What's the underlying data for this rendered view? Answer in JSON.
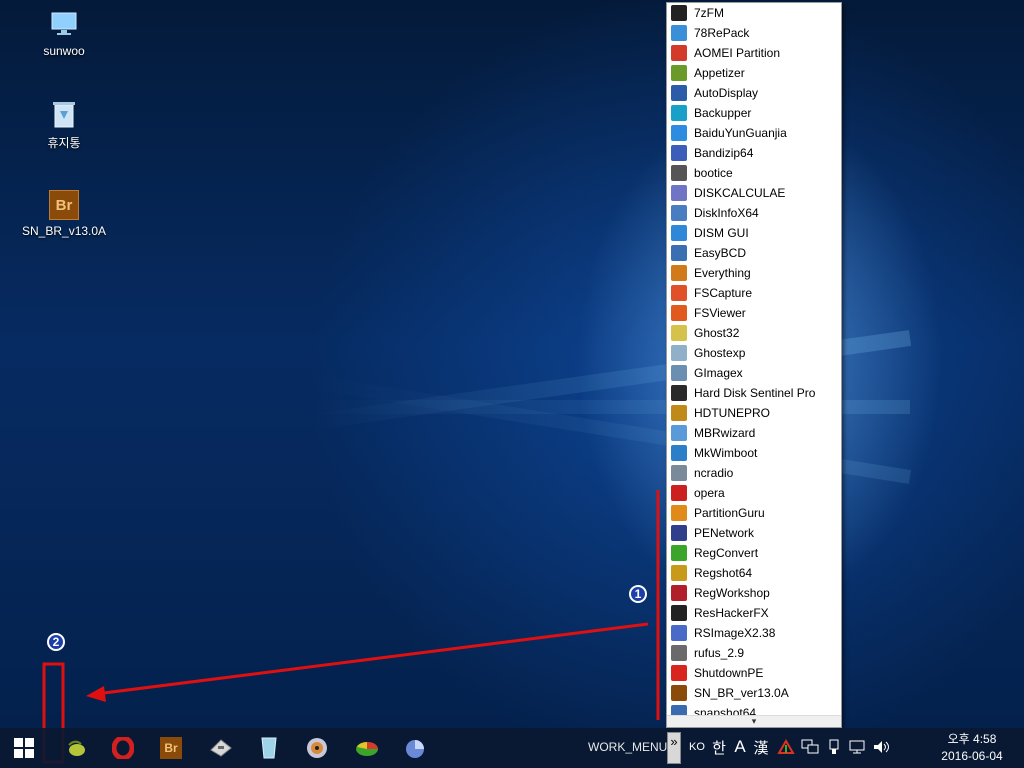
{
  "desktop": {
    "icons": [
      {
        "label": "sunwoo",
        "icon": "computer-icon"
      },
      {
        "label": "휴지통",
        "icon": "recycle-bin-icon"
      },
      {
        "label": "SN_BR_v13.0A",
        "icon": "br-app-icon"
      }
    ]
  },
  "menu": {
    "items": [
      {
        "label": "7zFM",
        "icon": "7zip-icon",
        "color": "#222222"
      },
      {
        "label": "78RePack",
        "icon": "triangle-icon",
        "color": "#3a8fd6"
      },
      {
        "label": "AOMEI Partition",
        "icon": "aomei-icon",
        "color": "#d23b2a"
      },
      {
        "label": "Appetizer",
        "icon": "appetizer-icon",
        "color": "#6a9a2a"
      },
      {
        "label": "AutoDisplay",
        "icon": "monitor-icon",
        "color": "#2a5ca8"
      },
      {
        "label": "Backupper",
        "icon": "backup-icon",
        "color": "#19a0c9"
      },
      {
        "label": "BaiduYunGuanjia",
        "icon": "cloud-icon",
        "color": "#2d8be0"
      },
      {
        "label": "Bandizip64",
        "icon": "bandizip-icon",
        "color": "#3b5fb8"
      },
      {
        "label": "bootice",
        "icon": "disk-icon",
        "color": "#555555"
      },
      {
        "label": "DISKCALCULAE",
        "icon": "disk-calc-icon",
        "color": "#6f74c4"
      },
      {
        "label": "DiskInfoX64",
        "icon": "person-icon",
        "color": "#4a7cc2"
      },
      {
        "label": "DISM GUI",
        "icon": "windows-icon",
        "color": "#2f87d8"
      },
      {
        "label": "EasyBCD",
        "icon": "easybcd-icon",
        "color": "#3a6fb2"
      },
      {
        "label": "Everything",
        "icon": "magnifier-icon",
        "color": "#d07a1c"
      },
      {
        "label": "FSCapture",
        "icon": "fscapture-icon",
        "color": "#e0512a"
      },
      {
        "label": "FSViewer",
        "icon": "fsviewer-icon",
        "color": "#e05a1e"
      },
      {
        "label": "Ghost32",
        "icon": "ghost-icon",
        "color": "#d4c24a"
      },
      {
        "label": "Ghostexp",
        "icon": "ghost-icon",
        "color": "#8fb0c8"
      },
      {
        "label": "GImagex",
        "icon": "gimagex-icon",
        "color": "#6a8fb0"
      },
      {
        "label": "Hard Disk Sentinel Pro",
        "icon": "hdd-icon",
        "color": "#2a2a2a"
      },
      {
        "label": "HDTUNEPRO",
        "icon": "hdtune-icon",
        "color": "#c08a1a"
      },
      {
        "label": "MBRwizard",
        "icon": "wizard-icon",
        "color": "#5a9ad8"
      },
      {
        "label": "MkWimboot",
        "icon": "wimboot-icon",
        "color": "#2a7fc8"
      },
      {
        "label": "ncradio",
        "icon": "grid-icon",
        "color": "#7a8a9a"
      },
      {
        "label": "opera",
        "icon": "opera-icon",
        "color": "#cc1f1f"
      },
      {
        "label": "PartitionGuru",
        "icon": "partitionguru-icon",
        "color": "#e08a1a"
      },
      {
        "label": "PENetwork",
        "icon": "network-icon",
        "color": "#2f3f8a"
      },
      {
        "label": "RegConvert",
        "icon": "regconvert-icon",
        "color": "#3aa52a"
      },
      {
        "label": "Regshot64",
        "icon": "regshot-icon",
        "color": "#c79a1a"
      },
      {
        "label": "RegWorkshop",
        "icon": "regworkshop-icon",
        "color": "#b0202a"
      },
      {
        "label": "ResHackerFX",
        "icon": "reshacker-icon",
        "color": "#222222"
      },
      {
        "label": "RSImageX2.38",
        "icon": "rsimagex-icon",
        "color": "#4a6ac8"
      },
      {
        "label": "rufus_2.9",
        "icon": "usb-icon",
        "color": "#6a6a6a"
      },
      {
        "label": "ShutdownPE",
        "icon": "power-icon",
        "color": "#d8261e"
      },
      {
        "label": "SN_BR_ver13.0A",
        "icon": "br-app-icon",
        "color": "#8a4a0a"
      },
      {
        "label": "snapshot64",
        "icon": "snapshot-icon",
        "color": "#3a6ab0"
      }
    ],
    "scroll_arrow": "▾"
  },
  "taskbar": {
    "apps": [
      {
        "icon": "start-windows-icon"
      },
      {
        "icon": "olive-app-icon"
      },
      {
        "icon": "opera-icon"
      },
      {
        "icon": "br-app-icon"
      },
      {
        "icon": "disk-icon"
      },
      {
        "icon": "glass-app-icon"
      },
      {
        "icon": "cd-icon"
      },
      {
        "icon": "partition-app-icon"
      },
      {
        "icon": "pie-app-icon"
      }
    ],
    "toolbar_label": "WORK_MENU",
    "toolbar_chevron": "»",
    "tray": {
      "lang": "KO",
      "ime_han": "한",
      "ime_a": "A",
      "ime_hanja": "漢"
    },
    "clock": {
      "time": "오후 4:58",
      "date": "2016-06-04"
    }
  },
  "annotations": {
    "marker1": "1",
    "marker2": "2",
    "line_color": "#e01010"
  }
}
